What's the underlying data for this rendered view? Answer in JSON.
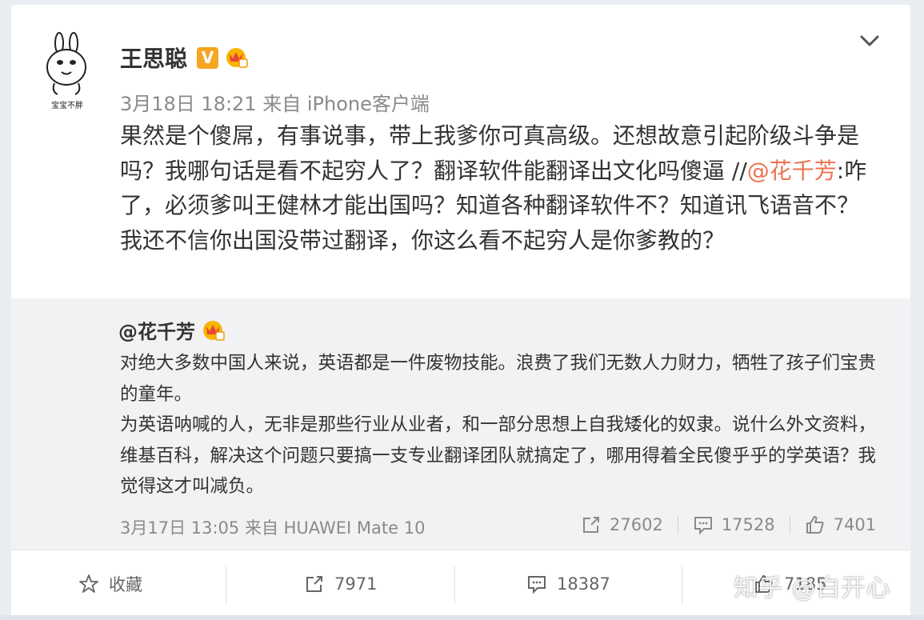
{
  "post": {
    "author": "王思聪",
    "verified_badge": "V",
    "meta": "3月18日 18:21 来自 iPhone客户端",
    "text_before_mention": "果然是个傻屌，有事说事，带上我爹你可真高级。还想故意引起阶级斗争是吗？我哪句话是看不起穷人了？翻译软件能翻译出文化吗傻逼 //",
    "mention": "@花千芳",
    "text_after_mention": ":咋了，必须爹叫王健林才能出国吗？知道各种翻译软件不？知道讯飞语音不？我还不信你出国没带过翻译，你这么看不起穷人是你爹教的？",
    "avatar_caption": "宝宝不胖"
  },
  "repost": {
    "author": "@花千芳",
    "paragraph_1": "对绝大多数中国人来说，英语都是一件废物技能。浪费了我们无数人力财力，牺牲了孩子们宝贵的童年。",
    "paragraph_2": "为英语呐喊的人，无非是那些行业从业者，和一部分思想上自我矮化的奴隶。说什么外文资料，维基百科，解决这个问题只要搞一支专业翻译团队就搞定了，哪用得着全民傻乎乎的学英语？我觉得这才叫减负。",
    "meta": "3月17日 13:05 来自 HUAWEI Mate 10",
    "repost_count": "27602",
    "comment_count": "17528",
    "like_count": "7401"
  },
  "bottom_bar": {
    "favorite_label": "收藏",
    "repost_count": "7971",
    "comment_count": "18387",
    "like_count": "7185"
  },
  "watermark": "知乎 @白开心",
  "colors": {
    "mention": "#eb7350",
    "badge": "#f5a623",
    "meta": "#8a8a8a",
    "repost_bg": "#f2f2f5"
  }
}
